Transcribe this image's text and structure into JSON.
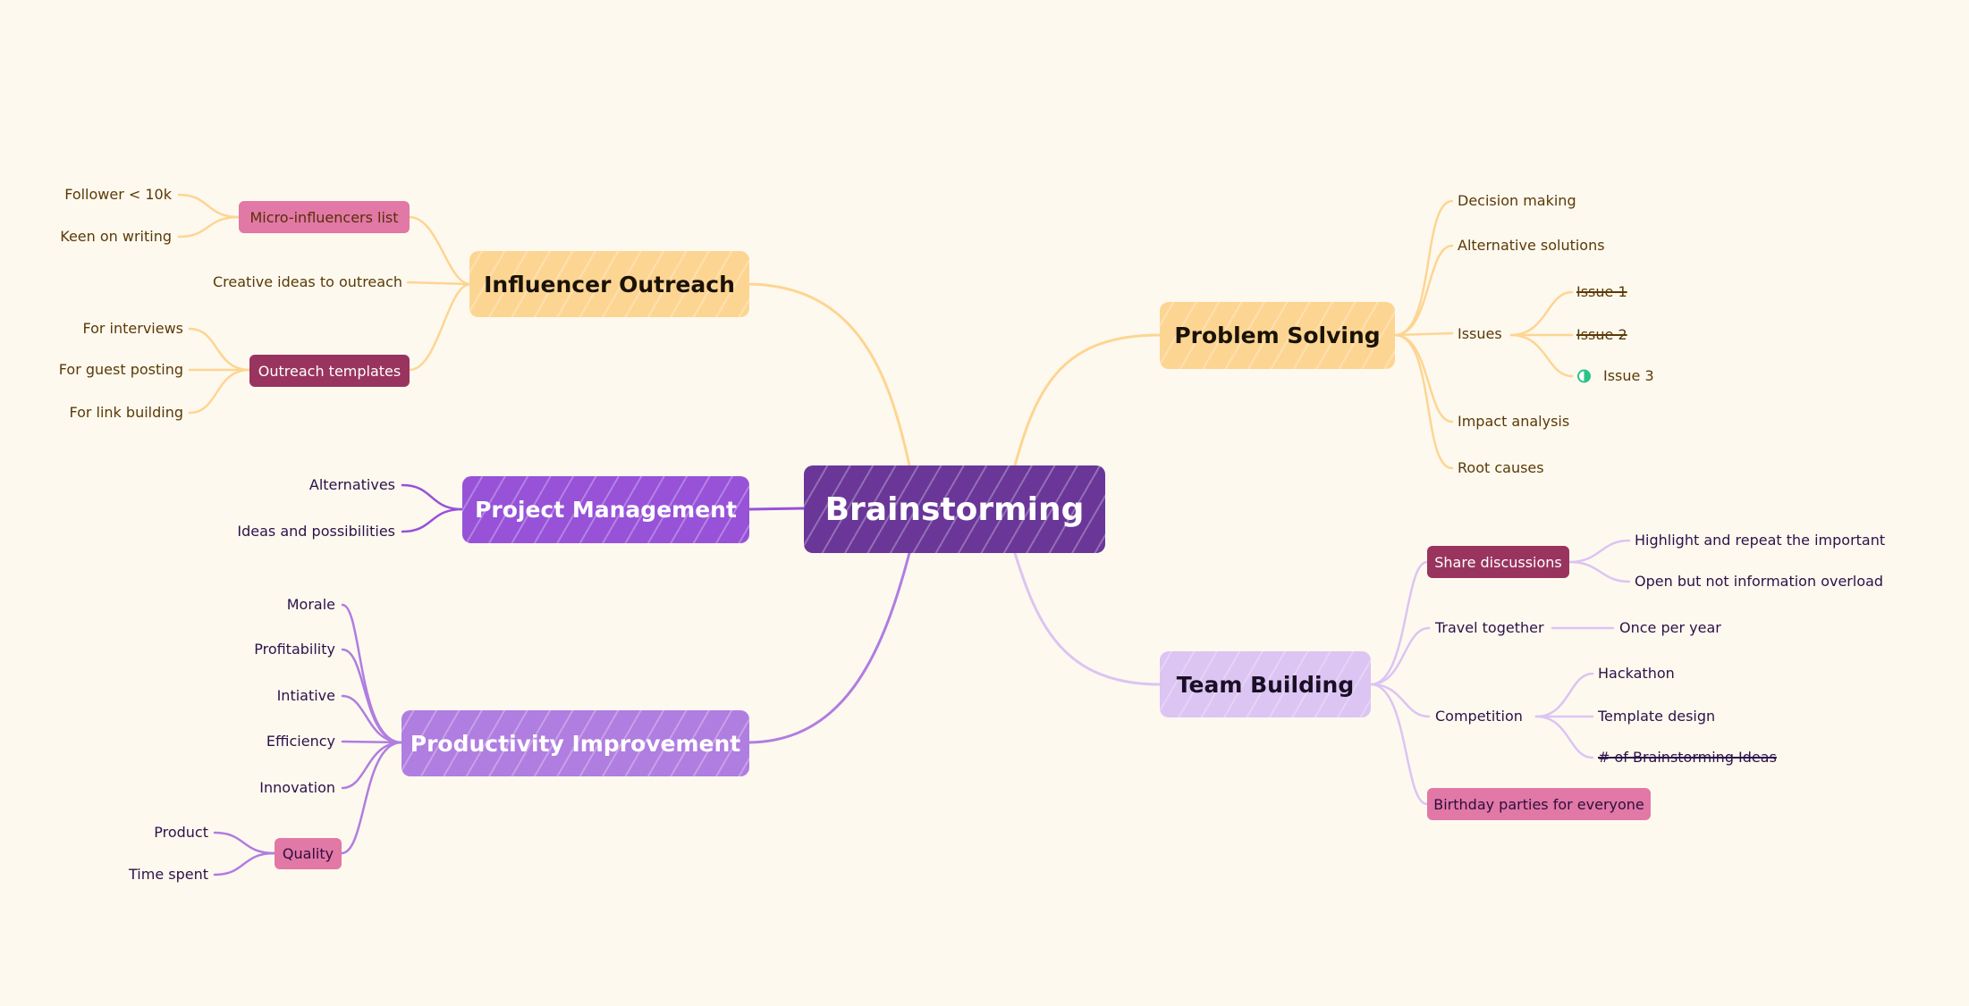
{
  "mindmap": {
    "root": "Brainstorming",
    "colors": {
      "background": "#fef9ef",
      "root": "#6a3799",
      "yellow_branch": "#fdd592",
      "purple_branch": "#9752d8",
      "lavender_branch": "#b07de0",
      "lilac_branch": "#dcc4f3",
      "pink_tag": "#e178a6",
      "wine_tag": "#99345e",
      "progress_green": "#2bc28a"
    },
    "influencer_outreach": {
      "label": "Influencer Outreach",
      "micro_influencers": {
        "label": "Micro-influencers list",
        "children": [
          "Follower < 10k",
          "Keen on writing"
        ]
      },
      "creative_ideas": "Creative ideas to outreach",
      "outreach_templates": {
        "label": "Outreach templates",
        "children": [
          "For interviews",
          "For guest posting",
          "For link building"
        ]
      }
    },
    "project_management": {
      "label": "Project Management",
      "children": [
        "Alternatives",
        "Ideas and possibilities"
      ]
    },
    "productivity_improvement": {
      "label": "Productivity Improvement",
      "children": [
        "Morale",
        "Profitability",
        "Intiative",
        "Efficiency",
        "Innovation"
      ],
      "quality": {
        "label": "Quality",
        "children": [
          "Product",
          "Time spent"
        ]
      }
    },
    "problem_solving": {
      "label": "Problem Solving",
      "decision_making": "Decision making",
      "alternative_solutions": "Alternative solutions",
      "issues": {
        "label": "Issues",
        "children": [
          {
            "label": "Issue 1",
            "done": true
          },
          {
            "label": "Issue 2",
            "done": true
          },
          {
            "label": "Issue 3",
            "done": false,
            "progress": 0.5
          }
        ]
      },
      "impact_analysis": "Impact analysis",
      "root_causes": "Root causes"
    },
    "team_building": {
      "label": "Team Building",
      "share_discussions": {
        "label": "Share discussions",
        "children": [
          "Highlight and repeat the important",
          "Open but not information overload"
        ]
      },
      "travel_together": {
        "label": "Travel together",
        "children": [
          "Once per year"
        ]
      },
      "competition": {
        "label": "Competition",
        "children": [
          {
            "label": "Hackathon",
            "done": false
          },
          {
            "label": "Template design",
            "done": false
          },
          {
            "label": "# of Brainstorming Ideas",
            "done": true
          }
        ]
      },
      "birthday": "Birthday parties for everyone"
    }
  }
}
